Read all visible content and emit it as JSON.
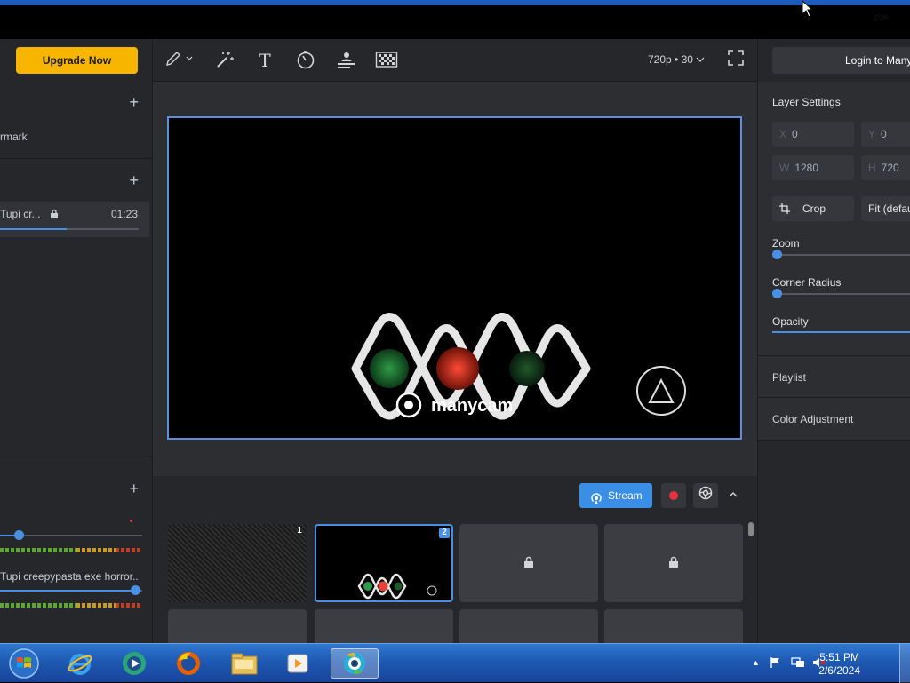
{
  "window": {
    "minimize_glyph": "–"
  },
  "left_panel": {
    "upgrade_label": "Upgrade Now",
    "section1": {
      "add_label": "+",
      "item_label": "rmark"
    },
    "section2": {
      "add_label": "+",
      "item_label": "Tupi cr...",
      "item_time": "01:23",
      "progress": 0.48
    },
    "section3": {
      "add_label": "+",
      "audio_label": "Tupi creepypasta exe horror...",
      "mic_level": 0.13,
      "media_level": 0.95
    }
  },
  "toolbar": {
    "tools": [
      "pen-icon",
      "magic-wand-icon",
      "text-icon",
      "timer-icon",
      "lower-third-icon",
      "chroma-key-icon"
    ],
    "text_tool_glyph": "T",
    "resolution": "720p • 30",
    "fullscreen_icon": "fullscreen-icon"
  },
  "preview": {
    "logo_text": "manycam"
  },
  "stream_bar": {
    "stream_label": "Stream",
    "chevron": "⌃"
  },
  "scenes": {
    "items": [
      {
        "num": "1",
        "state": "noise"
      },
      {
        "num": "2",
        "state": "active"
      },
      {
        "num": "",
        "state": "locked"
      },
      {
        "num": "",
        "state": "locked"
      }
    ]
  },
  "right_panel": {
    "login_label": "Login to Many",
    "layer_settings_title": "Layer Settings",
    "x_label": "X",
    "x_value": "0",
    "y_label": "Y",
    "y_value": "0",
    "w_label": "W",
    "w_value": "1280",
    "h_label": "H",
    "h_value": "720",
    "crop_label": "Crop",
    "fit_label": "Fit (defau",
    "zoom_label": "Zoom",
    "zoom_value": 0,
    "corner_radius_label": "Corner Radius",
    "corner_radius_value": 0,
    "opacity_label": "Opacity",
    "playlist_label": "Playlist",
    "color_adjustment_label": "Color Adjustment"
  },
  "taskbar": {
    "time": "5:51 PM",
    "date": "2/6/2024",
    "tray_up": "▲"
  }
}
